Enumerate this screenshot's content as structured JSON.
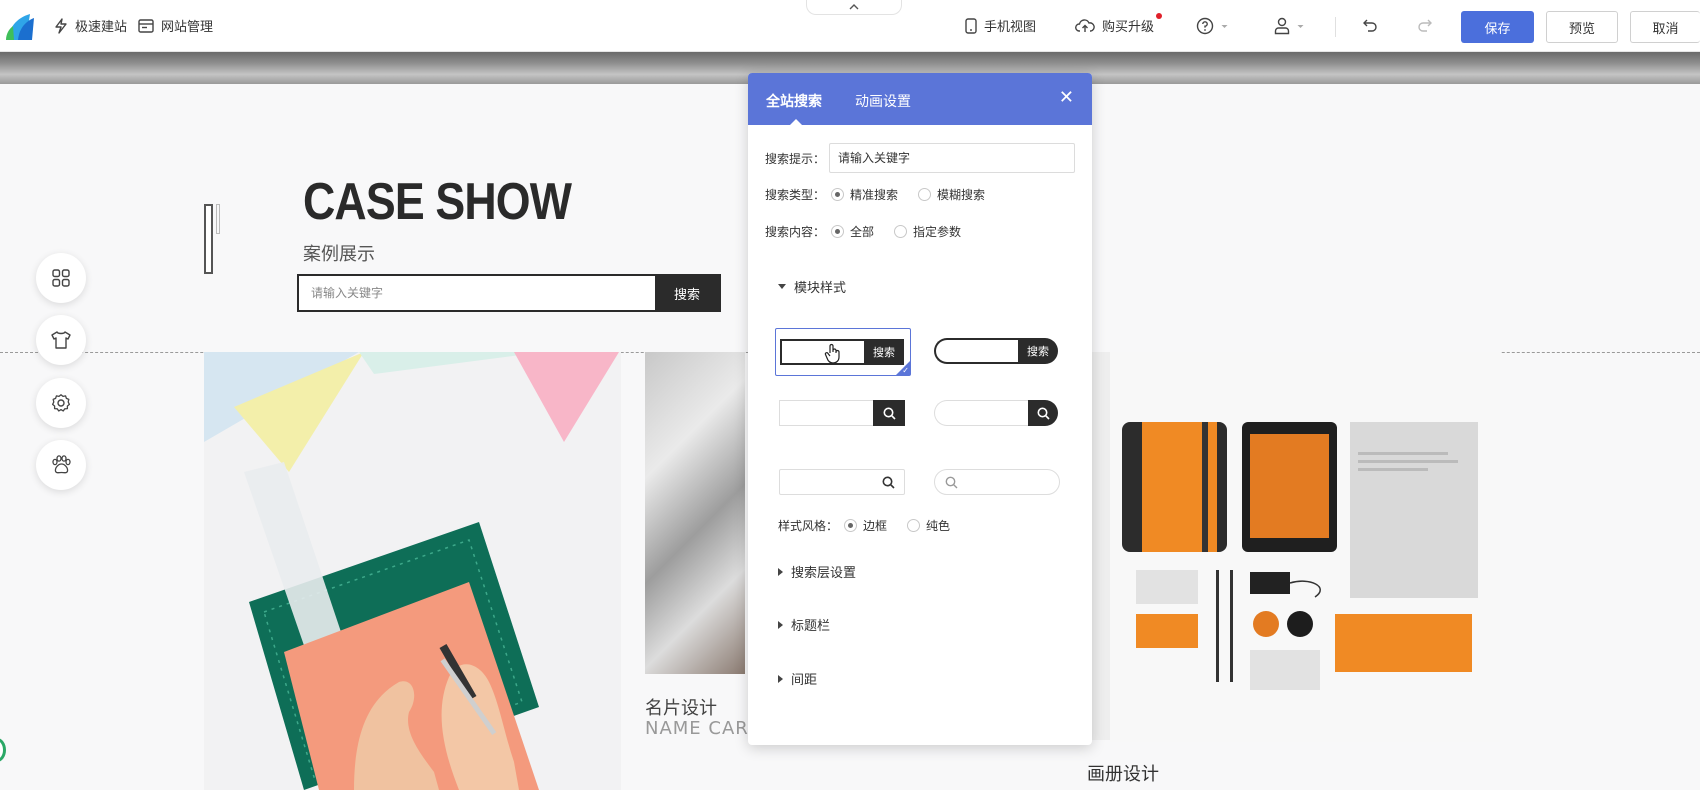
{
  "toolbar": {
    "quick_build": "极速建站",
    "site_manage": "网站管理",
    "mobile_view": "手机视图",
    "buy_upgrade": "购买升级",
    "save": "保存",
    "preview": "预览",
    "cancel": "取消"
  },
  "page": {
    "case_title": "CASE SHOW",
    "case_subtitle": "案例展示",
    "search_placeholder": "请输入关键字",
    "search_button": "搜索",
    "card2_title": "名片设计",
    "card2_subtitle": "NAME CARD",
    "card3_title": "画册设计"
  },
  "panel": {
    "tabs": [
      "全站搜索",
      "动画设置"
    ],
    "hint_label": "搜索提示：",
    "hint_value": "请输入关键字",
    "type_label": "搜索类型：",
    "type_options": [
      "精准搜索",
      "模糊搜索"
    ],
    "content_label": "搜索内容：",
    "content_options": [
      "全部",
      "指定参数"
    ],
    "module_style": "模块样式",
    "option_button": "搜索",
    "style_label": "样式风格：",
    "style_options": [
      "边框",
      "纯色"
    ],
    "sections": [
      "搜索层设置",
      "标题栏",
      "间距"
    ]
  },
  "colors": {
    "accent": "#5b75d8",
    "save_button": "#4b6fdc",
    "dark": "#2b2b2b",
    "notify_dot": "#e0202a"
  }
}
